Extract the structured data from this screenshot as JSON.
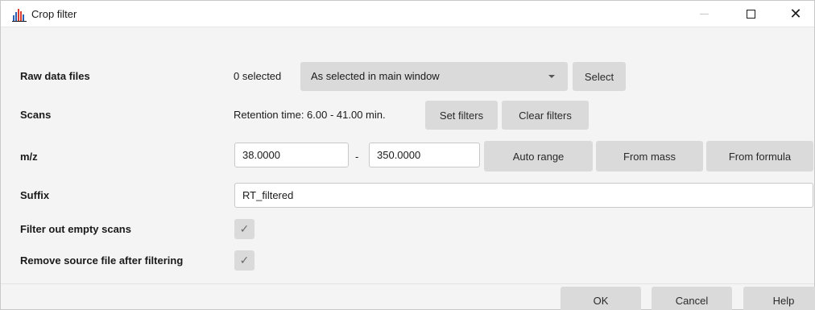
{
  "window": {
    "title": "Crop filter",
    "icon": "bar-chart-icon",
    "controls": {
      "minimize": "minimize-icon",
      "maximize": "maximize-icon",
      "close": "close-icon"
    }
  },
  "raw_data_files": {
    "label": "Raw data files",
    "selected_count": "0 selected",
    "dropdown_value": "As selected in main window",
    "select_button": "Select"
  },
  "scans": {
    "label": "Scans",
    "retention_text": "Retention time: 6.00 - 41.00 min.",
    "set_filters": "Set filters",
    "clear_filters": "Clear filters"
  },
  "mz": {
    "label": "m/z",
    "min": "38.0000",
    "separator": "-",
    "max": "350.0000",
    "auto_range": "Auto range",
    "from_mass": "From mass",
    "from_formula": "From formula"
  },
  "suffix": {
    "label": "Suffix",
    "value": "RT_filtered"
  },
  "filter_empty": {
    "label": "Filter out empty scans",
    "checked": true
  },
  "remove_source": {
    "label": "Remove source file after filtering",
    "checked": true
  },
  "footer": {
    "ok": "OK",
    "cancel": "Cancel",
    "help": "Help"
  },
  "colors": {
    "button_bg": "#dadada",
    "window_bg": "#f4f4f4",
    "icon_blue": "#2b5fb3",
    "icon_red": "#d83a2e"
  }
}
